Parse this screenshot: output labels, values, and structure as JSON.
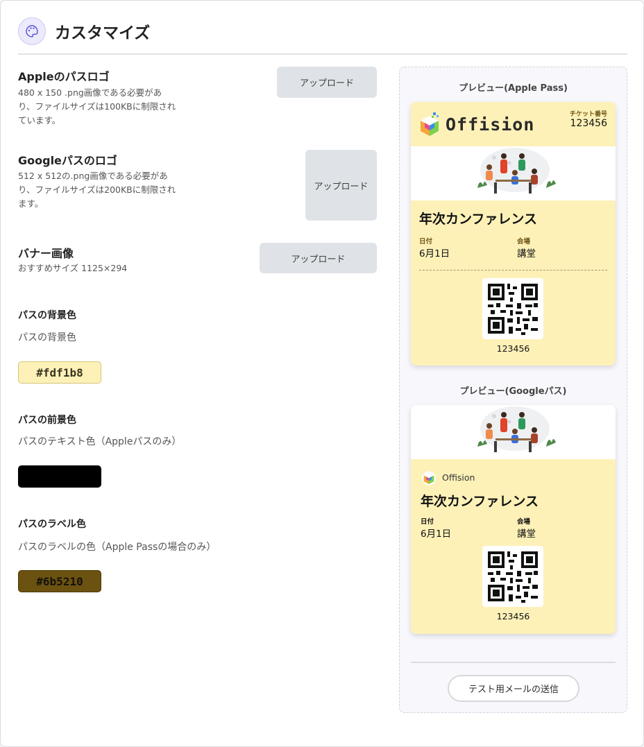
{
  "header": {
    "title": "カスタマイズ",
    "icon": "palette-icon"
  },
  "apple_logo": {
    "title": "Appleのパスロゴ",
    "desc_lines": [
      "480 x 150 .png画像である必要があ",
      "り、ファイルサイズは100KBに制限され",
      "ています。"
    ],
    "button": "アップロード"
  },
  "google_logo": {
    "title": "Googleパスのロゴ",
    "desc_lines": [
      "512 x 512の.png画像である必要があ",
      "り、ファイルサイズは200KBに制限され",
      "ます。"
    ],
    "button": "アップロード"
  },
  "banner_image": {
    "title": "バナー画像",
    "desc": "おすすめサイズ 1125×294",
    "button": "アップロード"
  },
  "bg_color": {
    "title": "パスの背景色",
    "desc": "パスの背景色",
    "value": "#fdf1b8"
  },
  "fg_color": {
    "title": "パスの前景色",
    "desc": "パスのテキスト色（Appleパスのみ）",
    "value": "",
    "color": "#000000"
  },
  "label_color": {
    "title": "パスのラベル色",
    "desc": "パスのラベルの色（Apple Passの場合のみ）",
    "value": "#6b5210"
  },
  "preview_apple": {
    "caption": "プレビュー(Apple Pass)",
    "logo_text": "Offision",
    "ticket_label": "チケット番号",
    "ticket_no": "123456",
    "event": "年次カンファレンス",
    "date_label": "日付",
    "date": "6月1日",
    "venue_label": "会場",
    "venue": "講堂",
    "qr_number": "123456"
  },
  "preview_google": {
    "caption": "プレビュー(Googleパス)",
    "logo_text": "Offision",
    "event": "年次カンファレンス",
    "date_label": "日付",
    "date": "6月1日",
    "venue_label": "会場",
    "venue": "講堂",
    "qr_number": "123456"
  },
  "test_email_button": "テスト用メールの送信"
}
